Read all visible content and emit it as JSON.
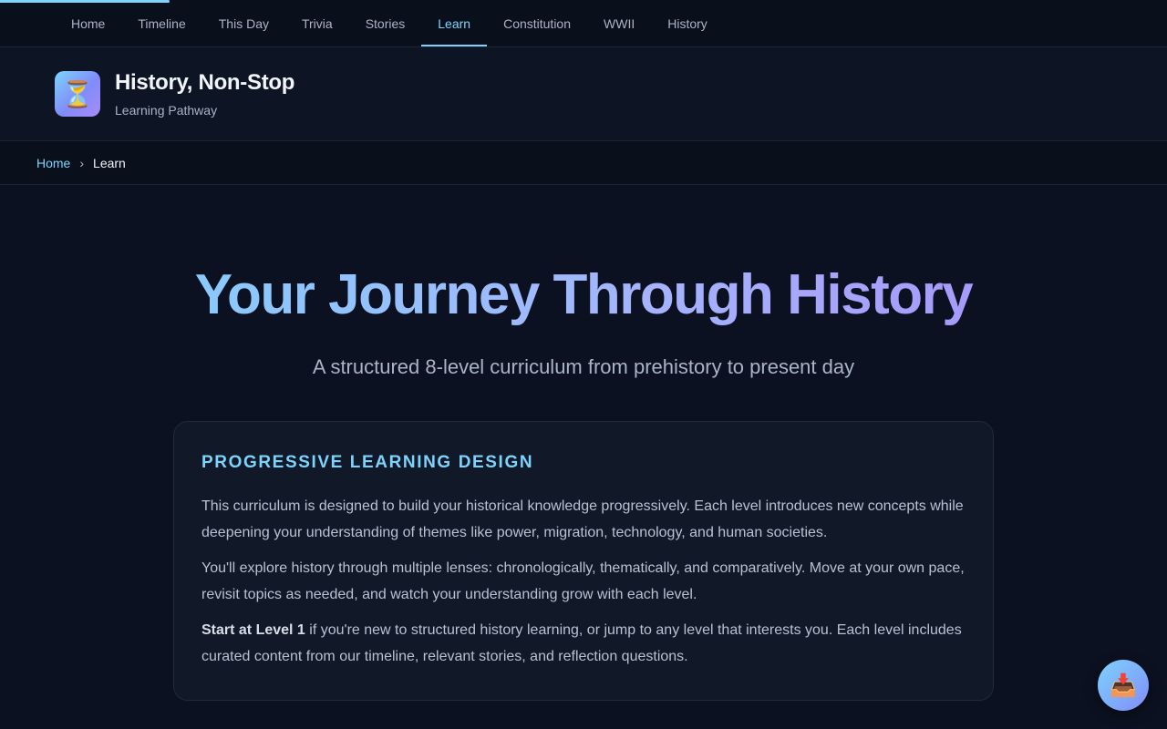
{
  "nav": {
    "items": [
      {
        "label": "Home"
      },
      {
        "label": "Timeline"
      },
      {
        "label": "This Day"
      },
      {
        "label": "Trivia"
      },
      {
        "label": "Stories"
      },
      {
        "label": "Learn"
      },
      {
        "label": "Constitution"
      },
      {
        "label": "WWII"
      },
      {
        "label": "History"
      }
    ],
    "active": "Learn"
  },
  "header": {
    "logo_icon": "hourglass-icon",
    "logo_glyph": "⏳",
    "title": "History, Non-Stop",
    "subtitle": "Learning Pathway"
  },
  "breadcrumb": {
    "home": "Home",
    "separator": "›",
    "current": "Learn"
  },
  "hero": {
    "title": "Your Journey Through History",
    "subtitle": "A structured 8-level curriculum from prehistory to present day"
  },
  "card": {
    "heading": "Progressive Learning Design",
    "p1": "This curriculum is designed to build your historical knowledge progressively. Each level introduces new concepts while deepening your understanding of themes like power, migration, technology, and human societies.",
    "p2": "You'll explore history through multiple lenses: chronologically, thematically, and comparatively. Move at your own pace, revisit topics as needed, and watch your understanding grow with each level.",
    "p3_bold": "Start at Level 1",
    "p3_rest": " if you're new to structured history learning, or jump to any level that interests you. Each level includes curated content from our timeline, relevant stories, and reflection questions."
  },
  "fab": {
    "icon": "inbox-tray-icon",
    "glyph": "📥"
  },
  "colors": {
    "background": "#0b1120",
    "accent": "#7dd3fc",
    "accent_purple": "#a78bfa",
    "card": "#111827"
  }
}
